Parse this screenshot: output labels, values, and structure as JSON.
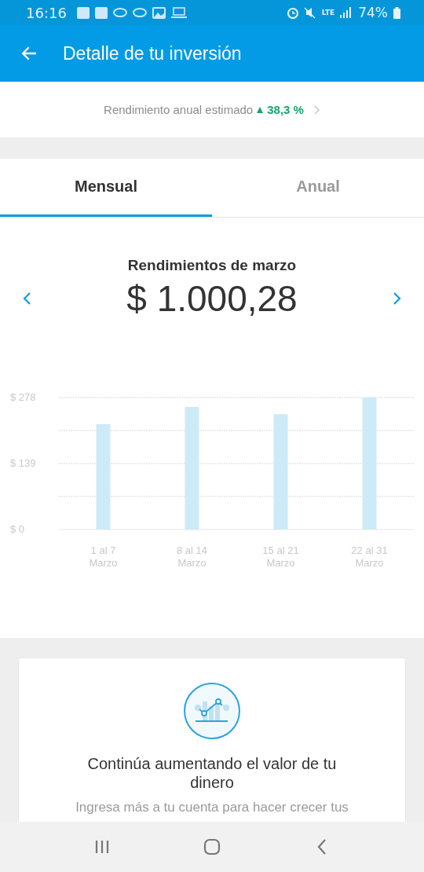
{
  "status_bar": {
    "time": "16:16",
    "network": "LTE",
    "battery": "74%"
  },
  "app_bar": {
    "title": "Detalle de tu inversión"
  },
  "summary": {
    "label": "Rendimiento anual estimado",
    "rising": true,
    "value": "38,3 %"
  },
  "tabs": [
    {
      "label": "Mensual",
      "selected": true
    },
    {
      "label": "Anual",
      "selected": false
    }
  ],
  "period": {
    "title": "Rendimientos de marzo",
    "amount": "$ 1.000,28"
  },
  "chart": {
    "chart_data": {
      "type": "bar",
      "categories": [
        "1 al 7\nMarzo",
        "8 al 14\nMarzo",
        "15 al 21\nMarzo",
        "22 al 31\nMarzo"
      ],
      "values": [
        222,
        258,
        243,
        278
      ],
      "ylim": [
        0,
        278
      ],
      "yticks": [
        {
          "value": 0,
          "label": "$ 0"
        },
        {
          "value": 139,
          "label": "$ 139"
        },
        {
          "value": 278,
          "label": "$ 278"
        }
      ]
    }
  },
  "promo_card": {
    "title": "Continúa aumentando el valor de tu dinero",
    "body": "Ingresa más a tu cuenta para hacer crecer tus"
  }
}
